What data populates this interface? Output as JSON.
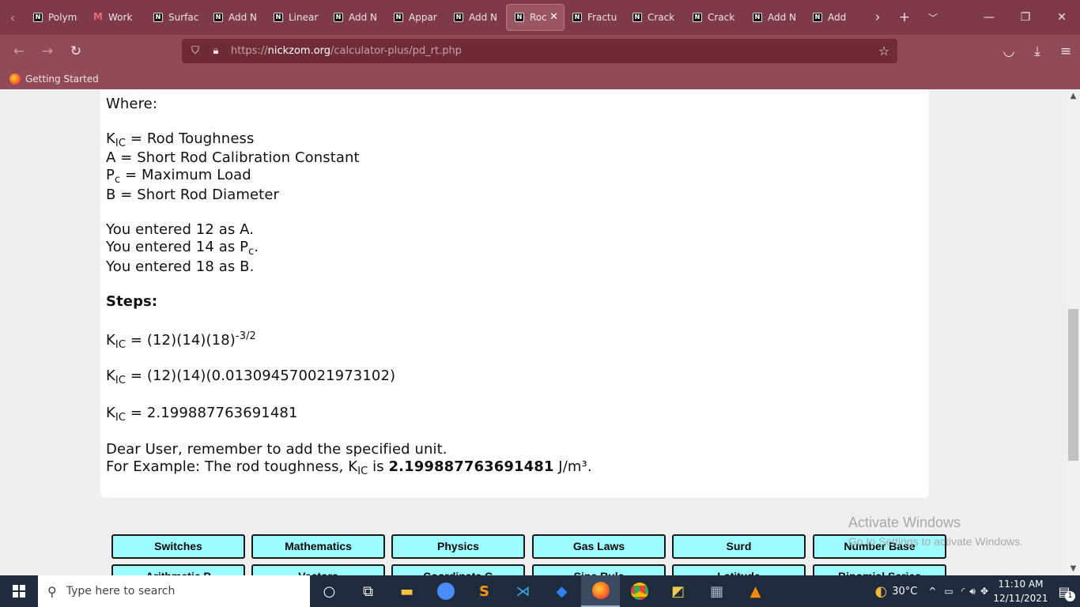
{
  "browser": {
    "tabs": [
      {
        "label": "Polym",
        "icon": "nickzom-icon"
      },
      {
        "label": "Work",
        "icon": "gmail-icon"
      },
      {
        "label": "Surfac",
        "icon": "nickzom-icon"
      },
      {
        "label": "Add N",
        "icon": "nickzom-icon"
      },
      {
        "label": "Linear",
        "icon": "nickzom-icon"
      },
      {
        "label": "Add N",
        "icon": "nickzom-icon"
      },
      {
        "label": "Appar",
        "icon": "nickzom-icon"
      },
      {
        "label": "Add N",
        "icon": "nickzom-icon"
      },
      {
        "label": "Roc",
        "icon": "nickzom-icon",
        "active": true
      },
      {
        "label": "Fractu",
        "icon": "nickzom-icon"
      },
      {
        "label": "Crack",
        "icon": "nickzom-icon"
      },
      {
        "label": "Crack",
        "icon": "nickzom-icon"
      },
      {
        "label": "Add N",
        "icon": "nickzom-icon"
      },
      {
        "label": "Add",
        "icon": "nickzom-icon"
      }
    ],
    "url_domain": "nickzom.org",
    "url_prefix": "https://",
    "url_path": "/calculator-plus/pd_rt.php",
    "bookmark": "Getting Started"
  },
  "content": {
    "where": "Where:",
    "defs": [
      {
        "sym": "K",
        "sub": "IC",
        "text": " = Rod Toughness"
      },
      {
        "sym": "",
        "sub": "",
        "text": "A = Short Rod Calibration Constant"
      },
      {
        "sym": "P",
        "sub": "c",
        "text": " = Maximum Load"
      },
      {
        "sym": "",
        "sub": "",
        "text": "B = Short Rod Diameter"
      }
    ],
    "entered": [
      {
        "pre": "You entered 12 as A.",
        "sub": "",
        "post": ""
      },
      {
        "pre": "You entered 14 as P",
        "sub": "c",
        "post": "."
      },
      {
        "pre": "You entered 18 as B.",
        "sub": "",
        "post": ""
      }
    ],
    "steps_label": "Steps:",
    "step1": {
      "sym": "K",
      "sub": "IC",
      "eq": " = (12)(14)(18)",
      "sup": "-3/2"
    },
    "step2": {
      "sym": "K",
      "sub": "IC",
      "eq": " = (12)(14)(0.013094570021973102)"
    },
    "step3": {
      "sym": "K",
      "sub": "IC",
      "eq": " = 2.199887763691481"
    },
    "reminder": "Dear User, remember to add the specified unit.",
    "example_pre": "For Example: The rod toughness, K",
    "example_sub": "IC",
    "example_mid": " is ",
    "example_value": "2.199887763691481",
    "example_unit": " J/m³."
  },
  "categories_row1": [
    "Switches",
    "Mathematics",
    "Physics",
    "Gas Laws",
    "Surd",
    "Number Base"
  ],
  "categories_row2": [
    "Arithmetic P",
    "Vectors",
    "Coordinate G",
    "Sine Rule",
    "Latitude",
    "Binomial Series"
  ],
  "watermark": {
    "title": "Activate Windows",
    "subtitle": "Go to Settings to activate Windows."
  },
  "taskbar": {
    "search_placeholder": "Type here to search",
    "weather": "30°C",
    "time": "11:10 AM",
    "date": "12/11/2021",
    "notification_count": "1"
  }
}
